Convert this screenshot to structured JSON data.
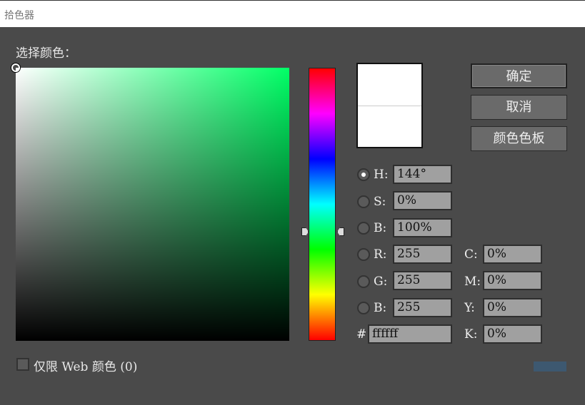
{
  "window": {
    "title": "拾色器"
  },
  "picker": {
    "label": "选择颜色：",
    "current_color": "#ffffff",
    "hue_color": "#00ff66"
  },
  "buttons": {
    "ok": "确定",
    "cancel": "取消",
    "swatches": "颜色色板"
  },
  "fields": {
    "h": {
      "label": "H:",
      "value": "144°",
      "selected": true
    },
    "s": {
      "label": "S:",
      "value": "0%"
    },
    "b": {
      "label": "B:",
      "value": "100%"
    },
    "r": {
      "label": "R:",
      "value": "255"
    },
    "g": {
      "label": "G:",
      "value": "255"
    },
    "b2": {
      "label": "B:",
      "value": "255"
    },
    "hex": {
      "label": "#",
      "value": "ffffff"
    },
    "c": {
      "label": "C:",
      "value": "0%"
    },
    "m": {
      "label": "M:",
      "value": "0%"
    },
    "y": {
      "label": "Y:",
      "value": "0%"
    },
    "k": {
      "label": "K:",
      "value": "0%"
    }
  },
  "web_only": {
    "label": "仅限 Web 颜色 (0)",
    "checked": false
  }
}
